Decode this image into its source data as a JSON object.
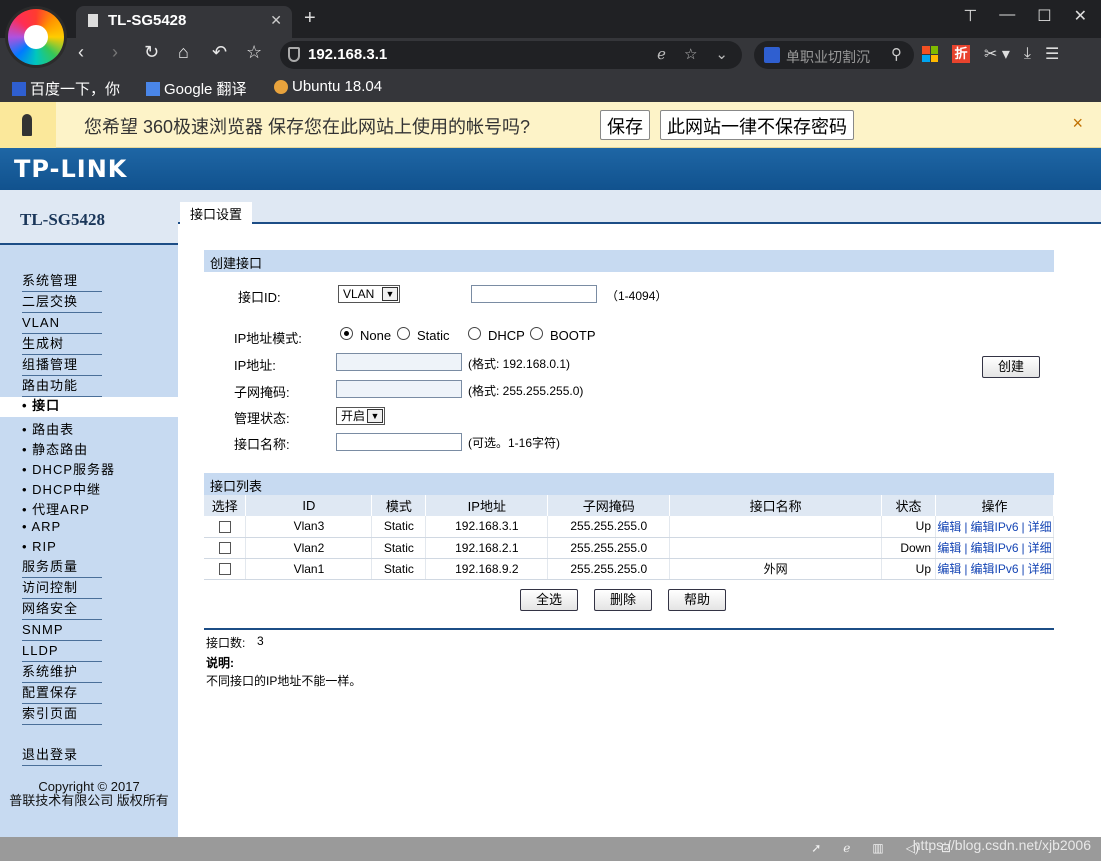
{
  "browser": {
    "tab_title": "TL-SG5428",
    "url": "192.168.3.1",
    "search_placeholder": "单职业切割沉",
    "bookmarks": [
      "百度一下，你",
      "Google 翻译",
      "Ubuntu 18.04"
    ],
    "ext_zhe": "折"
  },
  "infobar": {
    "message": "您希望 360极速浏览器 保存您在此网站上使用的帐号吗?",
    "save_label": "保存",
    "never_label": "此网站一律不保存密码",
    "close": "×"
  },
  "page": {
    "brand": "TP-LINK",
    "model": "TL-SG5428",
    "active_tab": "接口设置",
    "copyright_line1": "Copyright © 2017",
    "copyright_line2": "普联技术有限公司 版权所有"
  },
  "sidebar": {
    "items": [
      "系统管理",
      "二层交换",
      "VLAN",
      "生成树",
      "组播管理",
      "路由功能"
    ],
    "active": "接口",
    "sub_items": [
      "路由表",
      "静态路由",
      "DHCP服务器",
      "DHCP中继",
      "代理ARP",
      "ARP",
      "RIP"
    ],
    "items2": [
      "服务质量",
      "访问控制",
      "网络安全",
      "SNMP",
      "LLDP",
      "系统维护",
      "配置保存",
      "索引页面"
    ],
    "logout": "退出登录"
  },
  "create": {
    "section_title": "创建接口",
    "iface_id_label": "接口ID:",
    "iface_type": "VLAN",
    "id_range": "（1-4094）",
    "ip_mode_label": "IP地址模式:",
    "modes": [
      "None",
      "Static",
      "DHCP",
      "BOOTP"
    ],
    "selected_mode": "None",
    "ip_label": "IP地址:",
    "ip_hint": "(格式:  192.168.0.1)",
    "mask_label": "子网掩码:",
    "mask_hint": "(格式:  255.255.255.0)",
    "admin_label": "管理状态:",
    "admin_value": "开启",
    "name_label": "接口名称:",
    "name_hint": "(可选。1-16字符)",
    "create_button": "创建"
  },
  "list": {
    "section_title": "接口列表",
    "columns": [
      "选择",
      "ID",
      "模式",
      "IP地址",
      "子网掩码",
      "接口名称",
      "状态",
      "操作"
    ],
    "rows": [
      {
        "id": "Vlan3",
        "mode": "Static",
        "ip": "192.168.3.1",
        "mask": "255.255.255.0",
        "name": "",
        "status": "Up"
      },
      {
        "id": "Vlan2",
        "mode": "Static",
        "ip": "192.168.2.1",
        "mask": "255.255.255.0",
        "name": "",
        "status": "Down"
      },
      {
        "id": "Vlan1",
        "mode": "Static",
        "ip": "192.168.9.2",
        "mask": "255.255.255.0",
        "name": "外网",
        "status": "Up"
      }
    ],
    "op_edit": "编辑",
    "op_edit_ipv6": "编辑IPv6",
    "op_detail": "详细",
    "select_all": "全选",
    "delete": "删除",
    "help": "帮助"
  },
  "footer": {
    "count_label": "接口数:",
    "count_value": "3",
    "note_title": "说明:",
    "note_text": "不同接口的IP地址不能一样。"
  },
  "status": {
    "watermark": "https://blog.csdn.net/xjb2006"
  }
}
